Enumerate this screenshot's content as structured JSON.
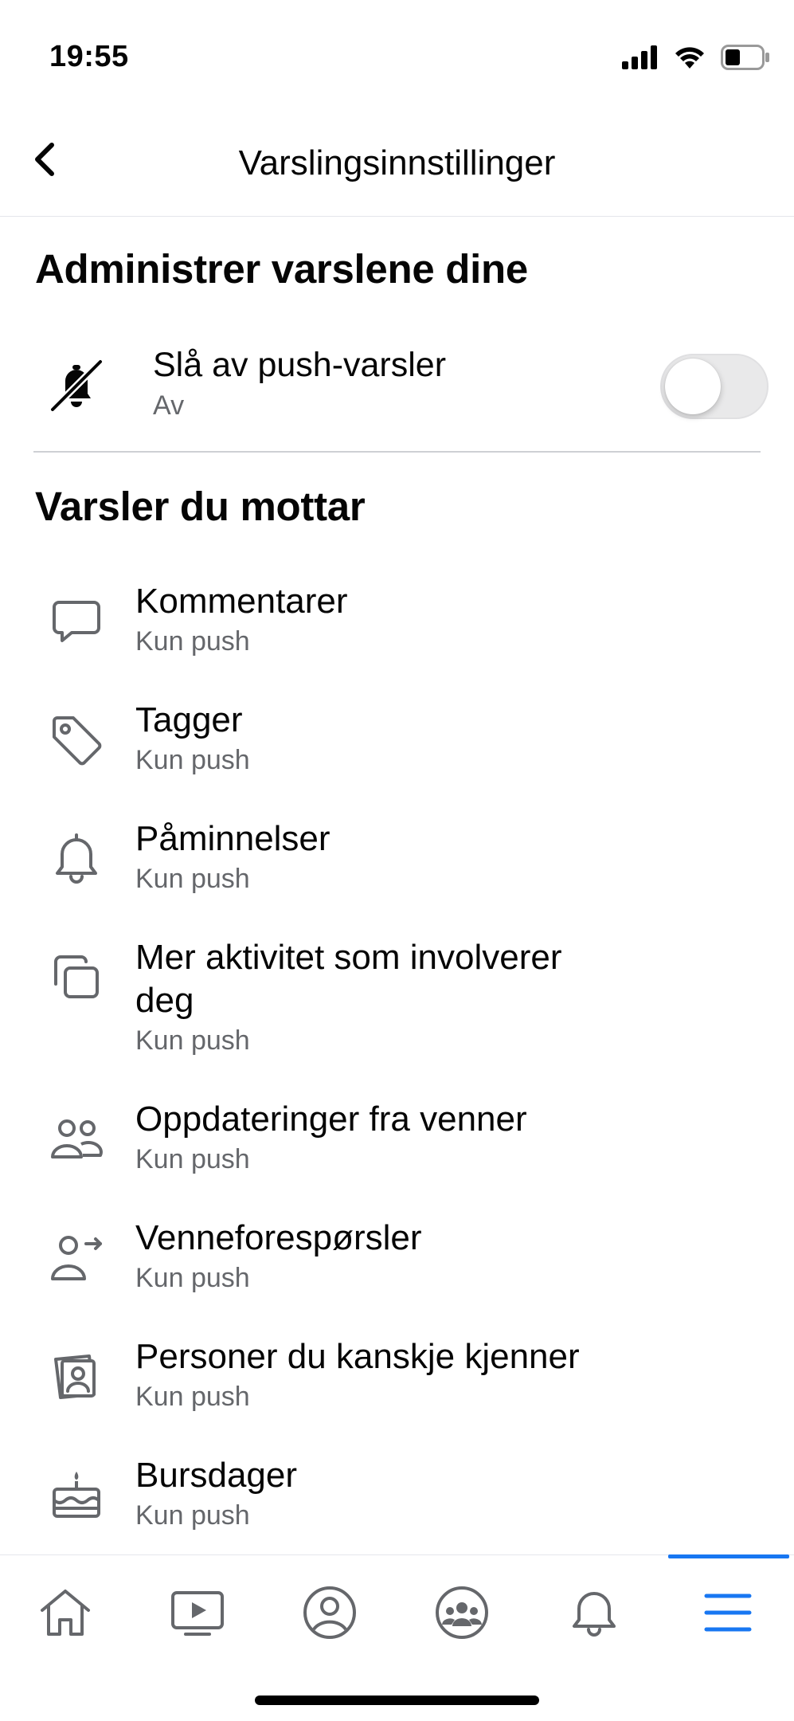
{
  "status_bar": {
    "time": "19:55",
    "icons": [
      "signal-icon",
      "wifi-icon",
      "battery-icon"
    ]
  },
  "nav": {
    "title": "Varslingsinnstillinger",
    "back_icon": "chevron-left-icon"
  },
  "manage_section": {
    "title": "Administrer varslene dine",
    "push_toggle": {
      "icon": "bell-off-icon",
      "label": "Slå av push-varsler",
      "status": "Av",
      "on": false
    }
  },
  "received_section": {
    "title": "Varsler du mottar",
    "items": [
      {
        "icon": "comment-icon",
        "label": "Kommentarer",
        "sub": "Kun push"
      },
      {
        "icon": "tag-icon",
        "label": "Tagger",
        "sub": "Kun push"
      },
      {
        "icon": "bell-icon",
        "label": "Påminnelser",
        "sub": "Kun push"
      },
      {
        "icon": "stacked-squares-icon",
        "label": "Mer aktivitet som involverer deg",
        "sub": "Kun push"
      },
      {
        "icon": "friends-icon",
        "label": "Oppdateringer fra venner",
        "sub": "Kun push"
      },
      {
        "icon": "friend-request-icon",
        "label": "Venneforespørsler",
        "sub": "Kun push"
      },
      {
        "icon": "people-you-may-know-icon",
        "label": "Personer du kanskje kjenner",
        "sub": "Kun push"
      },
      {
        "icon": "birthday-cake-icon",
        "label": "Bursdager",
        "sub": "Kun push"
      }
    ]
  },
  "tab_bar": {
    "tabs": [
      "home-icon",
      "video-icon",
      "profile-icon",
      "groups-icon",
      "notifications-icon",
      "menu-icon"
    ],
    "active_tab": "menu-icon",
    "accent_color": "#1877f2"
  }
}
